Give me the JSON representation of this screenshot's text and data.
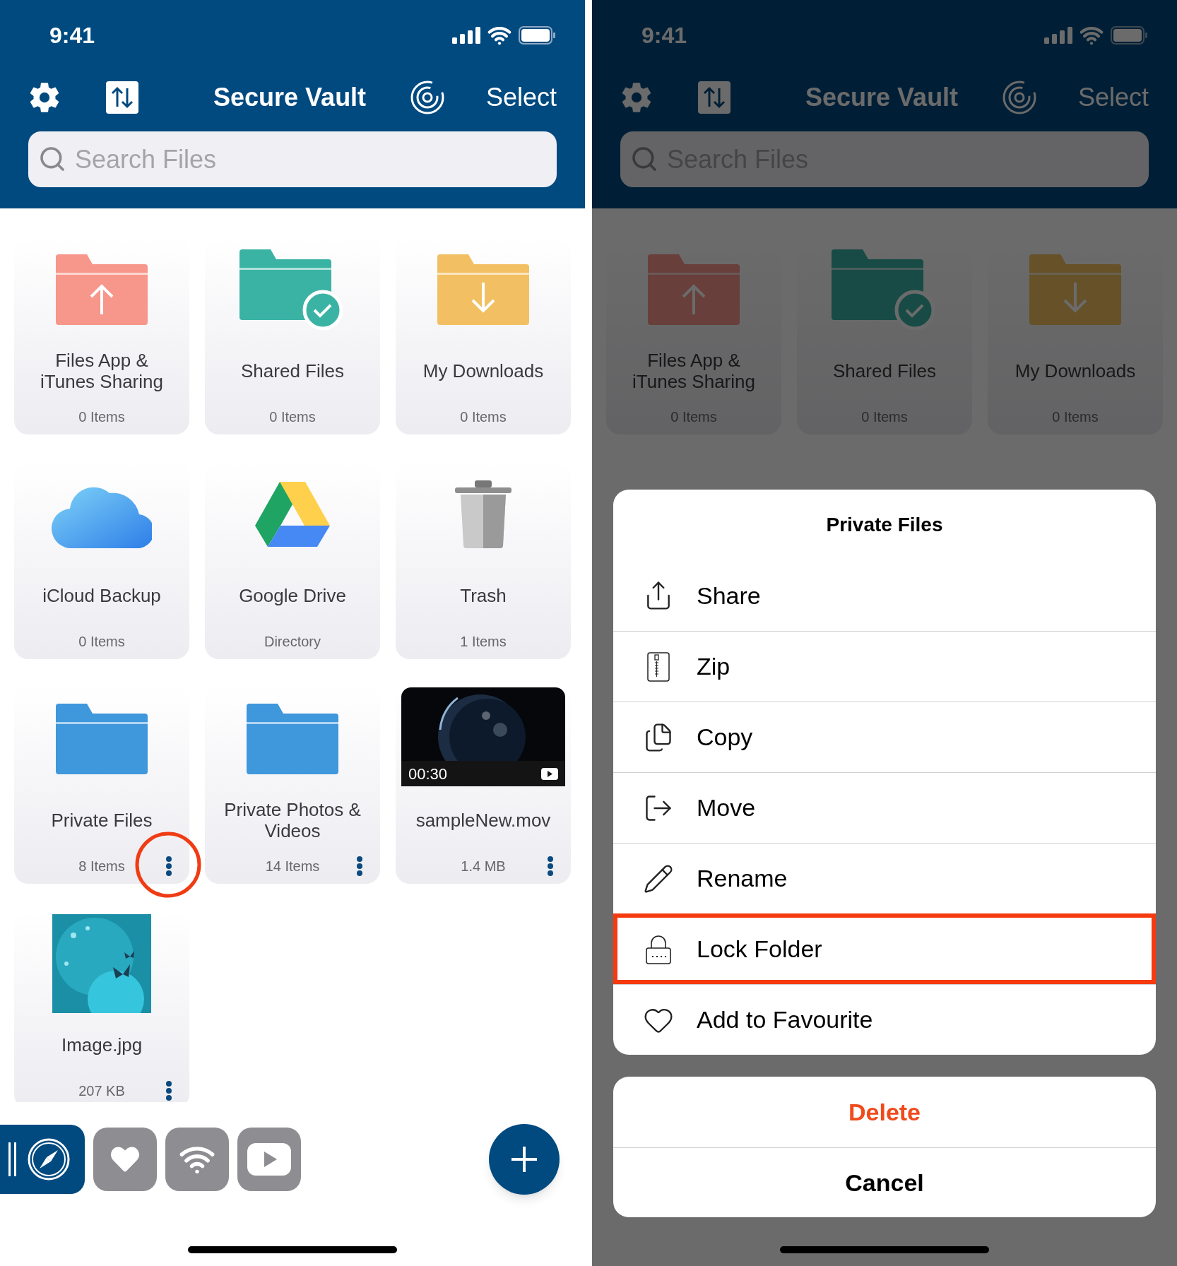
{
  "screens": [
    {
      "dimmed": false,
      "status_bar": {
        "time": "9:41"
      },
      "header": {
        "title": "Secure Vault",
        "select": "Select"
      },
      "search": {
        "placeholder": "Search Files"
      },
      "tiles": [
        {
          "kind": "upload-folder",
          "name": "Files App & iTunes Sharing",
          "meta": "0 Items",
          "menu": false,
          "highlighted": false
        },
        {
          "kind": "shared-folder",
          "name": "Shared Files",
          "meta": "0 Items",
          "menu": false,
          "highlighted": false
        },
        {
          "kind": "download-folder",
          "name": "My Downloads",
          "meta": "0 Items",
          "menu": false,
          "highlighted": false
        },
        {
          "kind": "cloud",
          "name": "iCloud Backup",
          "meta": "0 Items",
          "menu": false,
          "highlighted": false
        },
        {
          "kind": "drive",
          "name": "Google Drive",
          "meta": "Directory",
          "menu": false,
          "highlighted": false
        },
        {
          "kind": "trash",
          "name": "Trash",
          "meta": "1 Items",
          "menu": false,
          "highlighted": false
        },
        {
          "kind": "folder",
          "name": "Private Files",
          "meta": "8 Items",
          "menu": true,
          "highlighted": true
        },
        {
          "kind": "folder",
          "name": "Private Photos & Videos",
          "meta": "14 Items",
          "menu": true,
          "highlighted": false
        },
        {
          "kind": "video",
          "name": "sampleNew.mov",
          "meta": "1.4 MB",
          "duration": "00:30",
          "menu": true,
          "highlighted": false
        },
        {
          "name": "Image.jpg",
          "meta": "207 KB",
          "menu": true,
          "highlighted": false
        }
      ],
      "dock": [
        {
          "kind": "browser",
          "selected": true
        },
        {
          "kind": "favorites",
          "selected": false
        },
        {
          "kind": "wifi",
          "selected": false
        },
        {
          "kind": "video",
          "selected": false
        }
      ]
    },
    {
      "dimmed": true,
      "status_bar": {
        "time": "9:41"
      },
      "header": {
        "title": "Secure Vault",
        "select": "Select"
      },
      "search": {
        "placeholder": "Search Files"
      },
      "tiles": [
        {
          "kind": "upload-folder",
          "name": "Files App & iTunes Sharing",
          "meta": "0 Items",
          "menu": false,
          "highlighted": false
        },
        {
          "kind": "shared-folder",
          "name": "Shared Files",
          "meta": "0 Items",
          "menu": false,
          "highlighted": false
        },
        {
          "kind": "download-folder",
          "name": "My Downloads",
          "meta": "0 Items",
          "menu": false,
          "highlighted": false
        }
      ],
      "action_sheet": {
        "title": "Private Files",
        "actions": [
          {
            "kind": "share",
            "label": "Share",
            "highlighted": false
          },
          {
            "kind": "zip",
            "label": "Zip",
            "highlighted": false
          },
          {
            "kind": "copy",
            "label": "Copy",
            "highlighted": false
          },
          {
            "kind": "move",
            "label": "Move",
            "highlighted": false
          },
          {
            "kind": "rename",
            "label": "Rename",
            "highlighted": false
          },
          {
            "kind": "lock",
            "label": "Lock Folder",
            "highlighted": true
          },
          {
            "kind": "favourite",
            "label": "Add to Favourite",
            "highlighted": false
          }
        ],
        "delete": "Delete",
        "cancel": "Cancel"
      }
    }
  ]
}
